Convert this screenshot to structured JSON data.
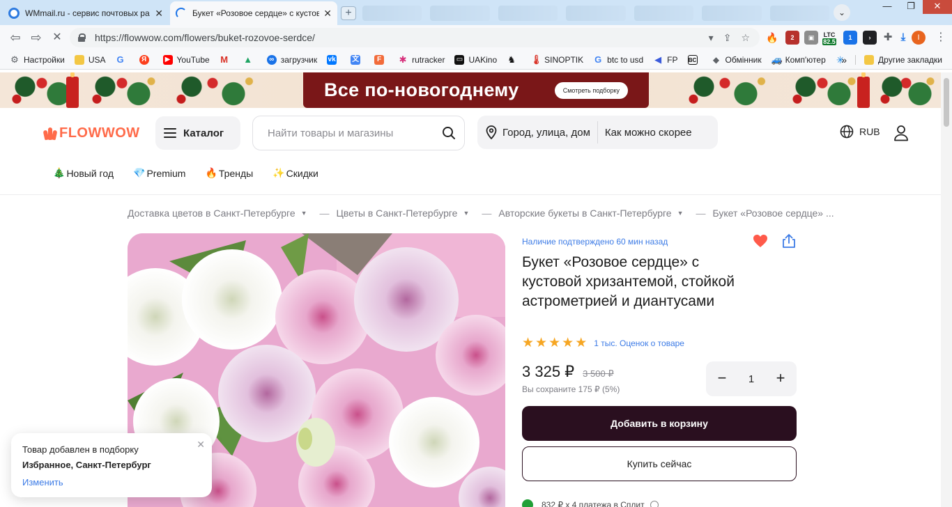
{
  "browser": {
    "tabs": [
      {
        "title": "WMmail.ru - сервис почтовых ра",
        "active": false
      },
      {
        "title": "Букет «Розовое сердце» с кустов",
        "active": true
      }
    ],
    "url": "https://flowwow.com/flowers/buket-rozovoe-serdce/",
    "extensions": {
      "ltc_label": "LTC",
      "ltc_value": "82.5",
      "badge1": "2",
      "badge2": "1"
    }
  },
  "bookmarks": {
    "items": [
      {
        "label": "Настройки",
        "icon": "gear-icon"
      },
      {
        "label": "USA",
        "icon": "folder-icon"
      },
      {
        "label": "",
        "icon": "google-icon"
      },
      {
        "label": "",
        "icon": "yandex-icon"
      },
      {
        "label": "YouTube",
        "icon": "youtube-icon"
      },
      {
        "label": "",
        "icon": "gmail-icon"
      },
      {
        "label": "",
        "icon": "drive-icon"
      },
      {
        "label": "загрузчик",
        "icon": "loop-icon"
      },
      {
        "label": "",
        "icon": "vk-icon"
      },
      {
        "label": "",
        "icon": "translate-icon"
      },
      {
        "label": "",
        "icon": "f-icon"
      },
      {
        "label": "rutracker",
        "icon": "rutracker-icon"
      },
      {
        "label": "UAKino",
        "icon": "uakino-icon"
      },
      {
        "label": "",
        "icon": "chess-icon"
      },
      {
        "label": "SINOPTIK",
        "icon": "thermometer-icon"
      },
      {
        "label": "btc to usd",
        "icon": "google-icon"
      },
      {
        "label": "FP",
        "icon": "fp-icon"
      },
      {
        "label": "",
        "icon": "bc-icon"
      },
      {
        "label": "Обмінник",
        "icon": "diamond-icon"
      },
      {
        "label": "Комп'ютер",
        "icon": "car-icon"
      },
      {
        "label": "",
        "icon": "star-icon"
      }
    ],
    "overflow": "»",
    "other": "Другие закладки"
  },
  "banner": {
    "title": "Все по-новогоднему",
    "button": "Смотреть подборку"
  },
  "header": {
    "logo": "FLOWWOW",
    "catalog": "Каталог",
    "search_placeholder": "Найти товары и магазины",
    "address": "Город, улица, дом",
    "delivery_time": "Как можно скорее",
    "currency": "RUB"
  },
  "categories": [
    {
      "emoji": "🎄",
      "label": "Новый год"
    },
    {
      "emoji": "💎",
      "label": "Premium"
    },
    {
      "emoji": "🔥",
      "label": "Тренды"
    },
    {
      "emoji": "✨",
      "label": "Скидки"
    }
  ],
  "breadcrumbs": [
    "Доставка цветов в Санкт-Петербурге",
    "Цветы в Санкт-Петербурге",
    "Авторские букеты в Санкт-Петербурге",
    "Букет «Розовое сердце» ..."
  ],
  "product": {
    "availability": "Наличие подтверждено 60 мин назад",
    "title": "Букет «Розовое сердце» с кустовой хризантемой, стойкой астрометрией и диантусами",
    "rating_stars": 5,
    "rating_link": "1 тыс. Оценок о товаре",
    "price": "3 325 ₽",
    "old_price": "3 500 ₽",
    "savings": "Вы сохраните 175 ₽ (5%)",
    "quantity": "1",
    "add_to_cart": "Добавить в корзину",
    "buy_now": "Купить сейчас",
    "split": "832 ₽ x 4 платежа в Сплит"
  },
  "toast": {
    "line1": "Товар добавлен в подборку",
    "line2": "Избранное, Санкт-Петербург",
    "action": "Изменить"
  },
  "colors": {
    "brand": "#ff6b4a",
    "primary_button": "#2a0f1f",
    "link": "#3c7be6",
    "banner_box": "#7a1718",
    "heart": "#ff5a4a",
    "star": "#f6a623"
  }
}
